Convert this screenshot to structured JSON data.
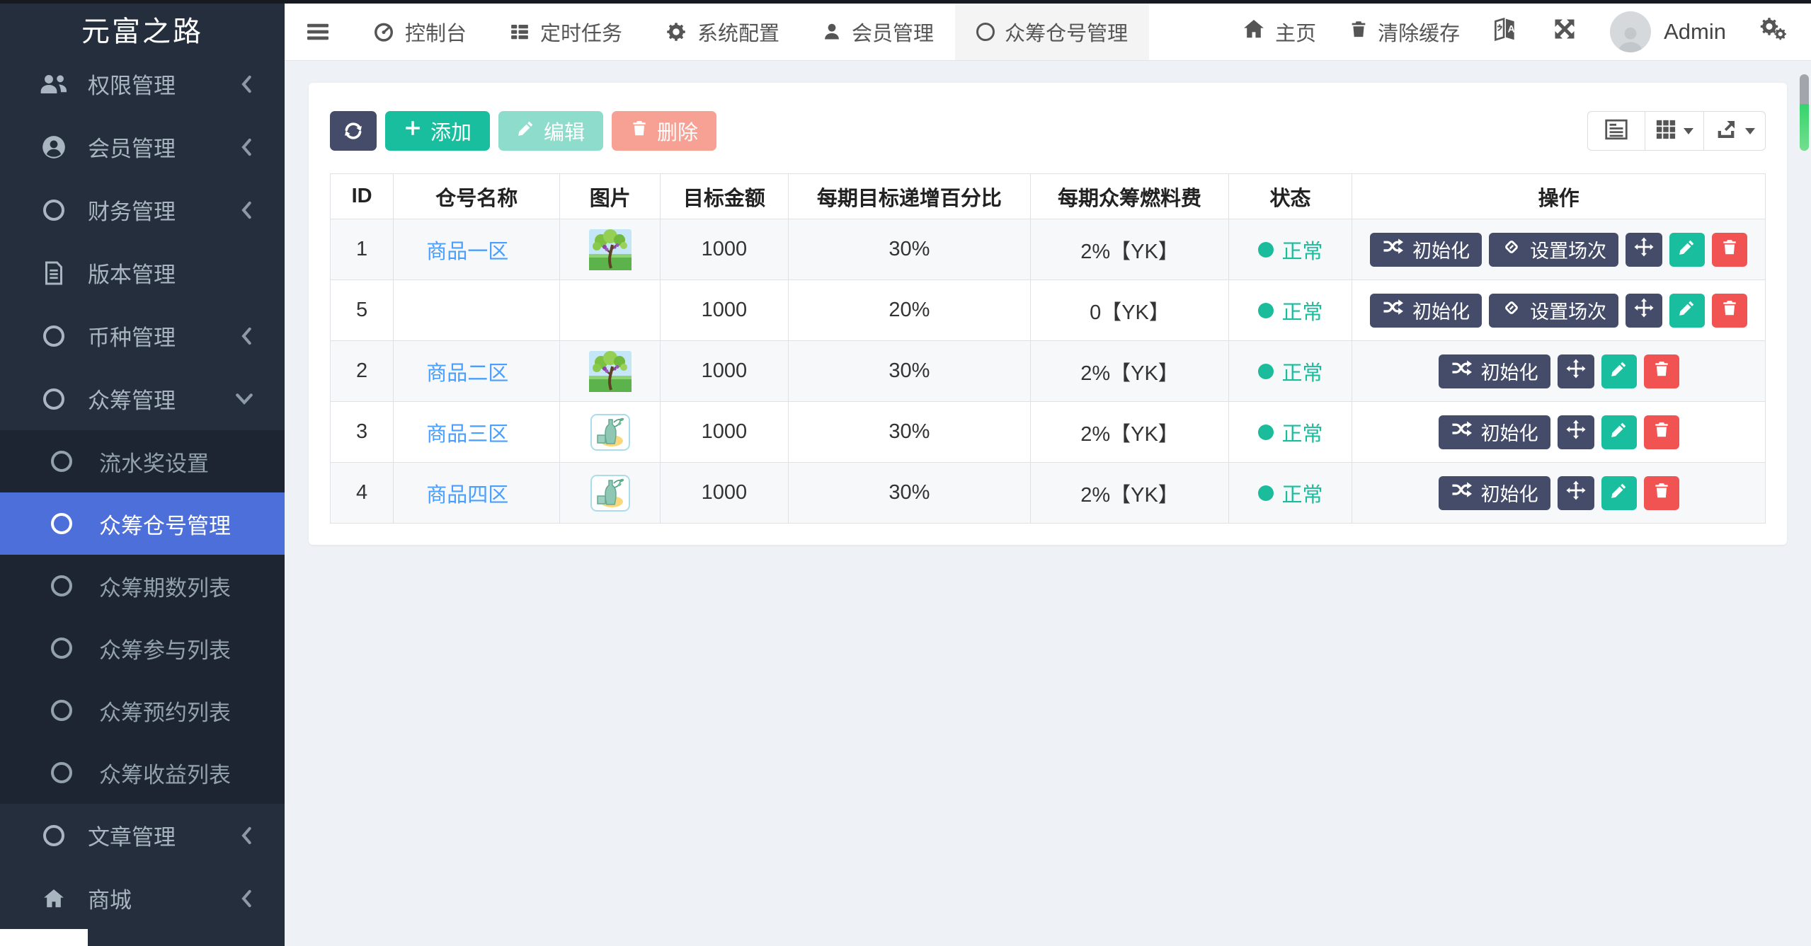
{
  "brand": {
    "title": "元富之路"
  },
  "sidebar": {
    "items": [
      {
        "label": "权限管理",
        "icon": "users-icon",
        "chevron": "left"
      },
      {
        "label": "会员管理",
        "icon": "user-circle-icon",
        "chevron": "left"
      },
      {
        "label": "财务管理",
        "icon": "circle-icon",
        "chevron": "left"
      },
      {
        "label": "版本管理",
        "icon": "file-icon",
        "chevron": "none"
      },
      {
        "label": "币种管理",
        "icon": "circle-icon",
        "chevron": "left"
      },
      {
        "label": "众筹管理",
        "icon": "circle-icon",
        "chevron": "down"
      }
    ],
    "submenu": [
      {
        "label": "流水奖设置",
        "active": false
      },
      {
        "label": "众筹仓号管理",
        "active": true
      },
      {
        "label": "众筹期数列表",
        "active": false
      },
      {
        "label": "众筹参与列表",
        "active": false
      },
      {
        "label": "众筹预约列表",
        "active": false
      },
      {
        "label": "众筹收益列表",
        "active": false
      }
    ],
    "items_after": [
      {
        "label": "文章管理",
        "icon": "circle-icon",
        "chevron": "left"
      },
      {
        "label": "商城",
        "icon": "home-icon",
        "chevron": "left"
      }
    ]
  },
  "topbar": {
    "tabs": [
      {
        "label": "控制台",
        "icon": "dashboard-icon",
        "active": false
      },
      {
        "label": "定时任务",
        "icon": "tasks-icon",
        "active": false
      },
      {
        "label": "系统配置",
        "icon": "gear-icon",
        "active": false
      },
      {
        "label": "会员管理",
        "icon": "user-icon",
        "active": false
      },
      {
        "label": "众筹仓号管理",
        "icon": "circle-icon",
        "active": true
      }
    ],
    "home": "主页",
    "clear_cache": "清除缓存",
    "username": "Admin"
  },
  "toolbar": {
    "add": "添加",
    "edit": "编辑",
    "delete": "删除"
  },
  "table": {
    "columns": [
      "ID",
      "仓号名称",
      "图片",
      "目标金额",
      "每期目标递增百分比",
      "每期众筹燃料费",
      "状态",
      "操作"
    ],
    "status_normal": "正常",
    "action_init": "初始化",
    "action_session": "设置场次",
    "rows": [
      {
        "id": "1",
        "name": "商品一区",
        "image": "tree",
        "amount": "1000",
        "percent": "30%",
        "fuel": "2%【YK】",
        "status": "正常",
        "session": true
      },
      {
        "id": "5",
        "name": "",
        "image": "",
        "amount": "1000",
        "percent": "20%",
        "fuel": "0【YK】",
        "status": "正常",
        "session": true
      },
      {
        "id": "2",
        "name": "商品二区",
        "image": "tree",
        "amount": "1000",
        "percent": "30%",
        "fuel": "2%【YK】",
        "status": "正常",
        "session": false
      },
      {
        "id": "3",
        "name": "商品三区",
        "image": "bottle",
        "amount": "1000",
        "percent": "30%",
        "fuel": "2%【YK】",
        "status": "正常",
        "session": false
      },
      {
        "id": "4",
        "name": "商品四区",
        "image": "bottle",
        "amount": "1000",
        "percent": "30%",
        "fuel": "2%【YK】",
        "status": "正常",
        "session": false
      }
    ]
  },
  "colors": {
    "sidebar_bg": "#242e3c",
    "submenu_bg": "#1c2531",
    "active_blue": "#4d6fd9",
    "primary_green": "#19be9e",
    "danger_red": "#f05352",
    "navy": "#444c69",
    "link_blue": "#4a9efc",
    "status_green": "#1abc9c"
  }
}
